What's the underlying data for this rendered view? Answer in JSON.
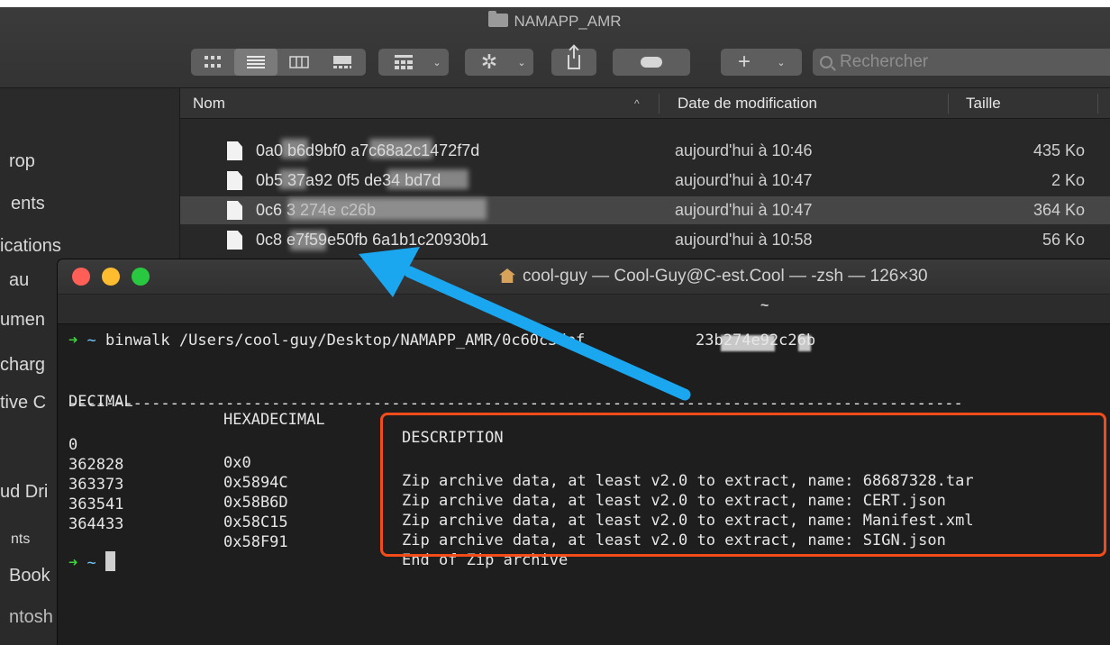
{
  "finder": {
    "title": "NAMAPP_AMR",
    "search_placeholder": "Rechercher",
    "sidebar": [
      "rop",
      "ents",
      "ications",
      "au",
      "umen",
      "charg",
      "tive C",
      "ud Dri",
      "nts",
      "Book",
      "ntosh"
    ],
    "columns": {
      "name": "Nom",
      "date": "Date de modification",
      "size": "Taille"
    },
    "files": [
      {
        "name": "0a0   b6d9bf0    a7c68a2c1472f7d",
        "date": "aujourd'hui à 10:46",
        "size": "435 Ko",
        "selected": false
      },
      {
        "name": "0b5   37a92   0f5   de34          bd7d",
        "date": "aujourd'hui à 10:47",
        "size": "2 Ko",
        "selected": false
      },
      {
        "name": "0c6   3                    274e   c26b",
        "date": "aujourd'hui à 10:47",
        "size": "364 Ko",
        "selected": true
      },
      {
        "name": "0c8    e7f59e50fb   6a1b1c20930b1",
        "date": "aujourd'hui à 10:58",
        "size": "56 Ko",
        "selected": false
      }
    ]
  },
  "terminal": {
    "title": "cool-guy — Cool-Guy@C-est.Cool — -zsh — 126×30",
    "tab_label": "~",
    "prompt_symbol": "➜",
    "prompt_dir": "~",
    "command": "binwalk /Users/cool-guy/Desktop/NAMAPP_AMR/0c60c3def            23b274e92c26b",
    "headers": {
      "decimal": "DECIMAL",
      "hex": "HEXADECIMAL",
      "desc": "DESCRIPTION"
    },
    "separator": "--------------------------------------------------------------------------------------------------------",
    "rows": [
      {
        "decimal": "0",
        "hex": "0x0",
        "desc": "Zip archive data, at least v2.0 to extract, name: 68687328.tar"
      },
      {
        "decimal": "362828",
        "hex": "0x5894C",
        "desc": "Zip archive data, at least v2.0 to extract, name: CERT.json"
      },
      {
        "decimal": "363373",
        "hex": "0x58B6D",
        "desc": "Zip archive data, at least v2.0 to extract, name: Manifest.xml"
      },
      {
        "decimal": "363541",
        "hex": "0x58C15",
        "desc": "Zip archive data, at least v2.0 to extract, name: SIGN.json"
      },
      {
        "decimal": "364433",
        "hex": "0x58F91",
        "desc": "End of Zip archive"
      }
    ]
  },
  "colors": {
    "arrow": "#1aa7ef",
    "highlight": "#f24c1b",
    "prompt_green": "#3ed13e"
  }
}
